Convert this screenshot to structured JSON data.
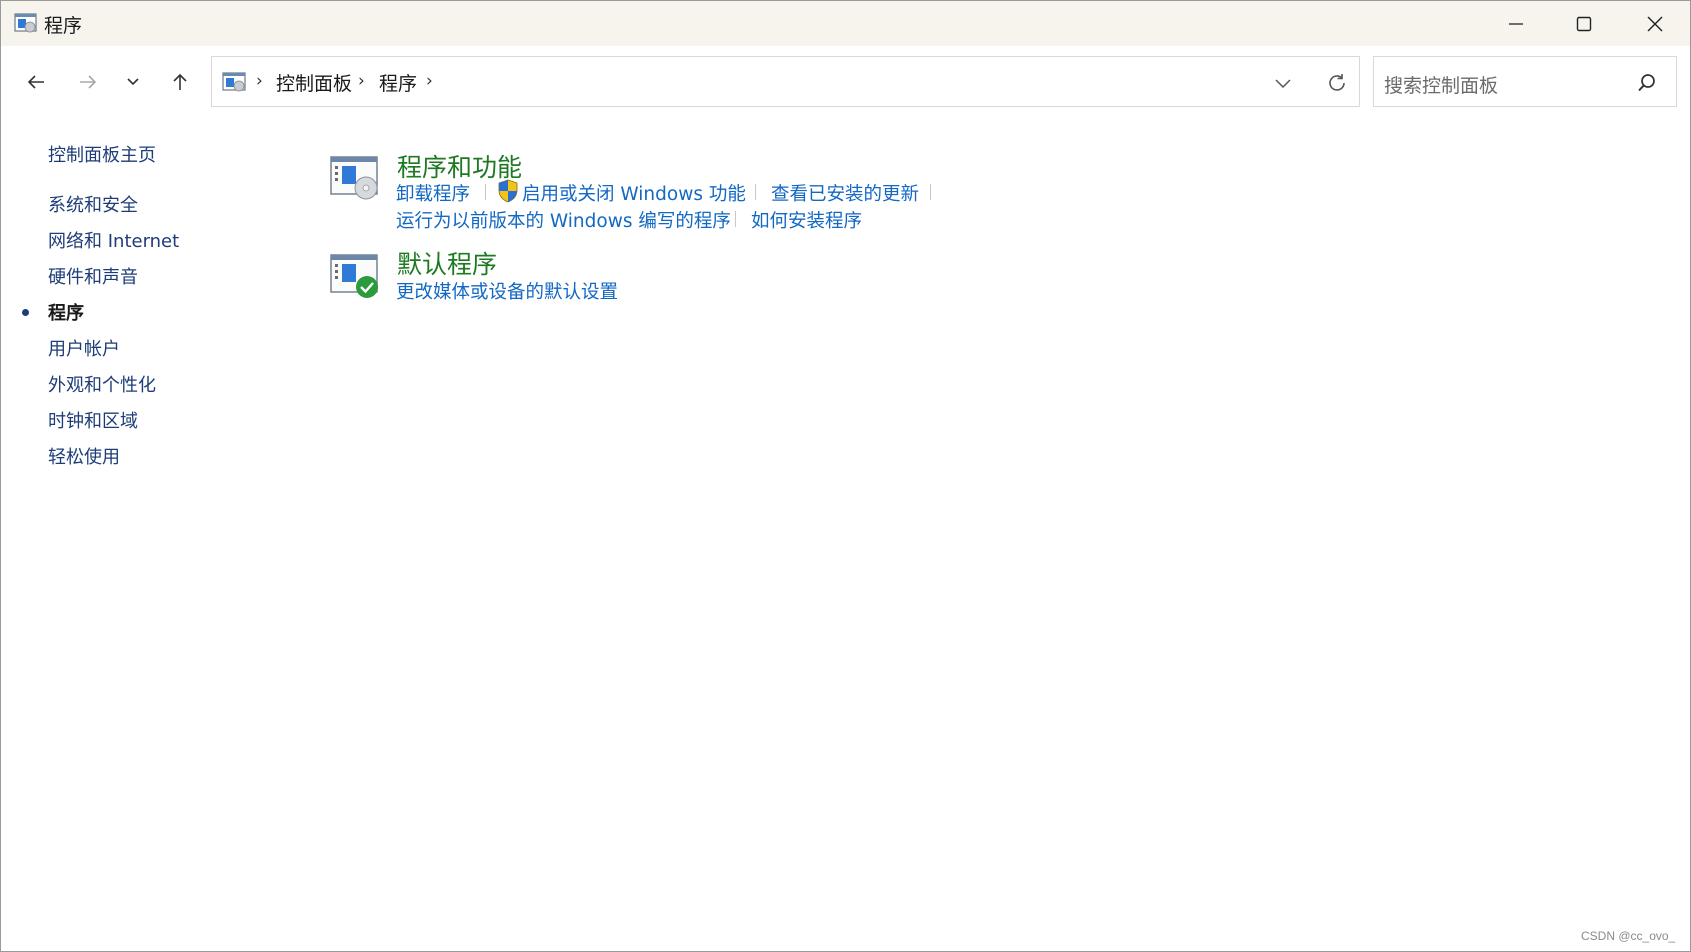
{
  "window": {
    "title": "程序"
  },
  "address": {
    "crumbs": [
      "控制面板",
      "程序"
    ]
  },
  "search": {
    "placeholder": "搜索控制面板"
  },
  "sidebar": {
    "home": "控制面板主页",
    "items": [
      {
        "label": "系统和安全"
      },
      {
        "label": "网络和 Internet"
      },
      {
        "label": "硬件和声音"
      },
      {
        "label": "程序",
        "current": true
      },
      {
        "label": "用户帐户"
      },
      {
        "label": "外观和个性化"
      },
      {
        "label": "时钟和区域"
      },
      {
        "label": "轻松使用"
      }
    ]
  },
  "sections": [
    {
      "title": "程序和功能",
      "icon": "programs-features-icon",
      "tasks": [
        "卸载程序",
        "启用或关闭 Windows 功能",
        "查看已安装的更新",
        "运行为以前版本的 Windows 编写的程序",
        "如何安装程序"
      ]
    },
    {
      "title": "默认程序",
      "icon": "default-programs-icon",
      "tasks": [
        "更改媒体或设备的默认设置"
      ]
    }
  ],
  "watermark": "CSDN @cc_ovo_",
  "colors": {
    "link": "#1368c4",
    "section_title": "#1d7a22",
    "sidebar_link": "#1e3d78",
    "titlebar_bg": "#f6f4ec"
  }
}
